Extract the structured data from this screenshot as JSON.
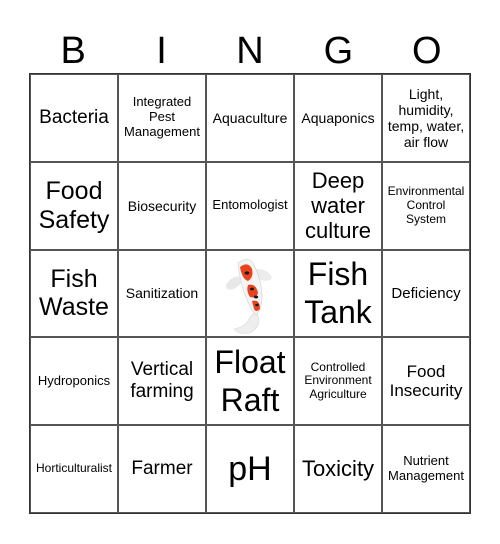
{
  "header": {
    "letters": [
      "B",
      "I",
      "N",
      "G",
      "O"
    ]
  },
  "board": {
    "rows": [
      [
        "Bacteria",
        "Integrated Pest Management",
        "Aquaculture",
        "Aquaponics",
        "Light, humidity, temp, water, air flow"
      ],
      [
        "Food Safety",
        "Biosecurity",
        "Entomologist",
        "Deep water culture",
        "Environmental Control System"
      ],
      [
        "Fish Waste",
        "Sanitization",
        "",
        "Fish Tank",
        "Deficiency"
      ],
      [
        "Hydroponics",
        "Vertical farming",
        "Float Raft",
        "Controlled Environment Agriculture",
        "Food Insecurity"
      ],
      [
        "Horticulturalist",
        "Farmer",
        "pH",
        "Toxicity",
        "Nutrient Management"
      ]
    ],
    "free_space": {
      "icon": "koi-fish-icon"
    }
  }
}
